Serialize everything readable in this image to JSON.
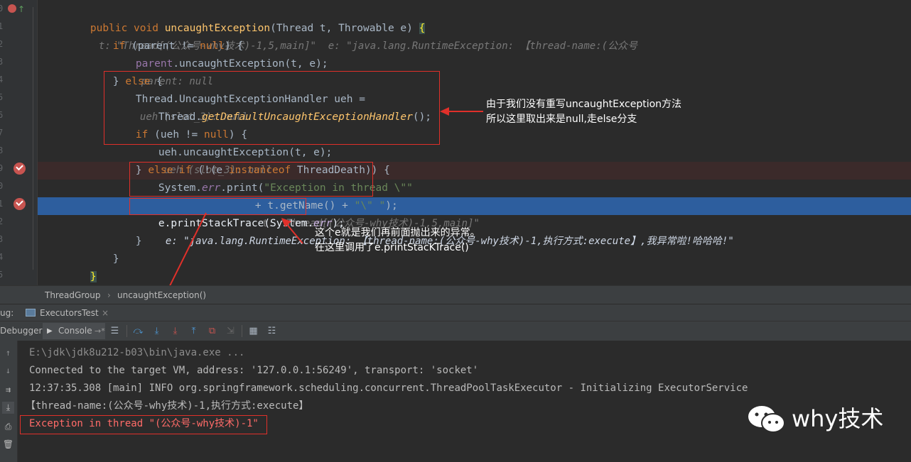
{
  "editor": {
    "gutter_numbers": [
      "0",
      "1",
      "2",
      "3",
      "4",
      "5",
      "6",
      "7",
      "8",
      "9",
      "0",
      "1",
      "2",
      "3",
      "4",
      "5"
    ],
    "lines": {
      "l0": {
        "kw1": "public void ",
        "fn": "uncaughtException",
        "rest": "(Thread t, Throwable e) ",
        "brace": "{",
        "hint": "t: \"Thread[(公众号-why技术)-1,5,main]\"  e: \"java.lang.RuntimeException: 【thread-name:(公众号"
      },
      "l1": {
        "kw": "if ",
        "a": "(parent != ",
        "null": "null",
        "b": ") {"
      },
      "l2": {
        "field": "parent",
        "a": ".uncaughtException(t, e);",
        "hint": "parent: null"
      },
      "l3": {
        "a": "} ",
        "kw": "else",
        "b": " {"
      },
      "l4": {
        "a": "Thread.UncaughtExceptionHandler ueh = ",
        "hint": "ueh (slot_3): null"
      },
      "l5": {
        "a": "Thread.",
        "it": "getDefaultUncaughtExceptionHandler",
        "b": "();"
      },
      "l6": {
        "kw": "if ",
        "a": "(ueh != ",
        "null": "null",
        "b": ") {"
      },
      "l7": {
        "a": "ueh.uncaughtException(t, e);",
        "hint": "ueh (slot_3): null"
      },
      "l8": {
        "a": "} ",
        "kw1": "else if ",
        "b": "(!(e ",
        "kw2": "instanceof ",
        "c": "ThreadDeath)) {"
      },
      "l9": {
        "a": "System.",
        "field": "err",
        "b": ".print(",
        "str": "\"Exception in thread \\\"\""
      },
      "l10": {
        "a": "+ t.getName() + ",
        "str": "\"\\\" \"",
        "b": ");",
        "hint": "t: \"Thread[(公众号-why技术)-1,5,main]\""
      },
      "l11": {
        "a": "e.printStackTrace(System.",
        "field": "err",
        "b": ");",
        "hint": "e: \"java.lang.RuntimeException: 【thread-name:(公众号-why技术)-1,执行方式:execute】,我异常啦!哈哈哈!\""
      },
      "l12": {
        "a": "}"
      },
      "l13": {
        "a": "}"
      },
      "l14": {
        "a": "}"
      }
    },
    "annotation1": "由于我们没有重写uncaughtException方法\n所以这里取出来是null,走else分支",
    "annotation2": "这个e就是我们再前面抛出来的异常。\n在这里调用了e.printStacKTrace()"
  },
  "breadcrumb": {
    "class": "ThreadGroup",
    "method": "uncaughtException()",
    "sep": "›"
  },
  "debug_bar": {
    "label": "ug:",
    "tab": "ExecutorsTest",
    "close": "×"
  },
  "toolbar": {
    "debugger": "Debugger",
    "console": "Console",
    "console_suffix": "→*"
  },
  "console": {
    "lines": [
      "E:\\jdk\\jdk8u212-b03\\bin\\java.exe ...",
      "Connected to the target VM, address: '127.0.0.1:56249', transport: 'socket'",
      "12:37:35.308 [main] INFO org.springframework.scheduling.concurrent.ThreadPoolTaskExecutor - Initializing ExecutorService",
      "【thread-name:(公众号-why技术)-1,执行方式:execute】",
      "Exception in thread \"(公众号-why技术)-1\""
    ]
  },
  "watermark": "why技术",
  "colors": {
    "accent_red": "#e0302a",
    "exec_line": "#2d5e9e",
    "error_text": "#ff6b68"
  }
}
